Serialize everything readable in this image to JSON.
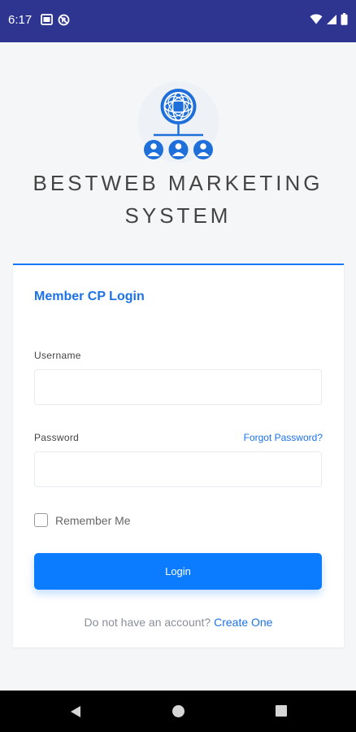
{
  "status_bar": {
    "time": "6:17",
    "icons_left": [
      "gallery-icon",
      "no-sync-icon"
    ],
    "icons_right": [
      "wifi-icon",
      "signal-icon",
      "battery-icon"
    ],
    "background": "#2e3591"
  },
  "brand": {
    "line1": "BESTWEB MARKETING",
    "line2": "SYSTEM",
    "logo_icon": "network-globe-icon"
  },
  "login_card": {
    "title": "Member CP Login",
    "username_label": "Username",
    "username_value": "",
    "password_label": "Password",
    "password_value": "",
    "forgot_password": "Forgot Password?",
    "remember_label": "Remember Me",
    "remember_checked": false,
    "login_button": "Login",
    "signup_prompt": "Do not have an account?",
    "signup_link": "Create One",
    "accent": "#1d72e8",
    "button_color": "#0b7bff"
  },
  "nav_bar": {
    "buttons": [
      "back-icon",
      "home-icon",
      "recents-icon"
    ]
  }
}
